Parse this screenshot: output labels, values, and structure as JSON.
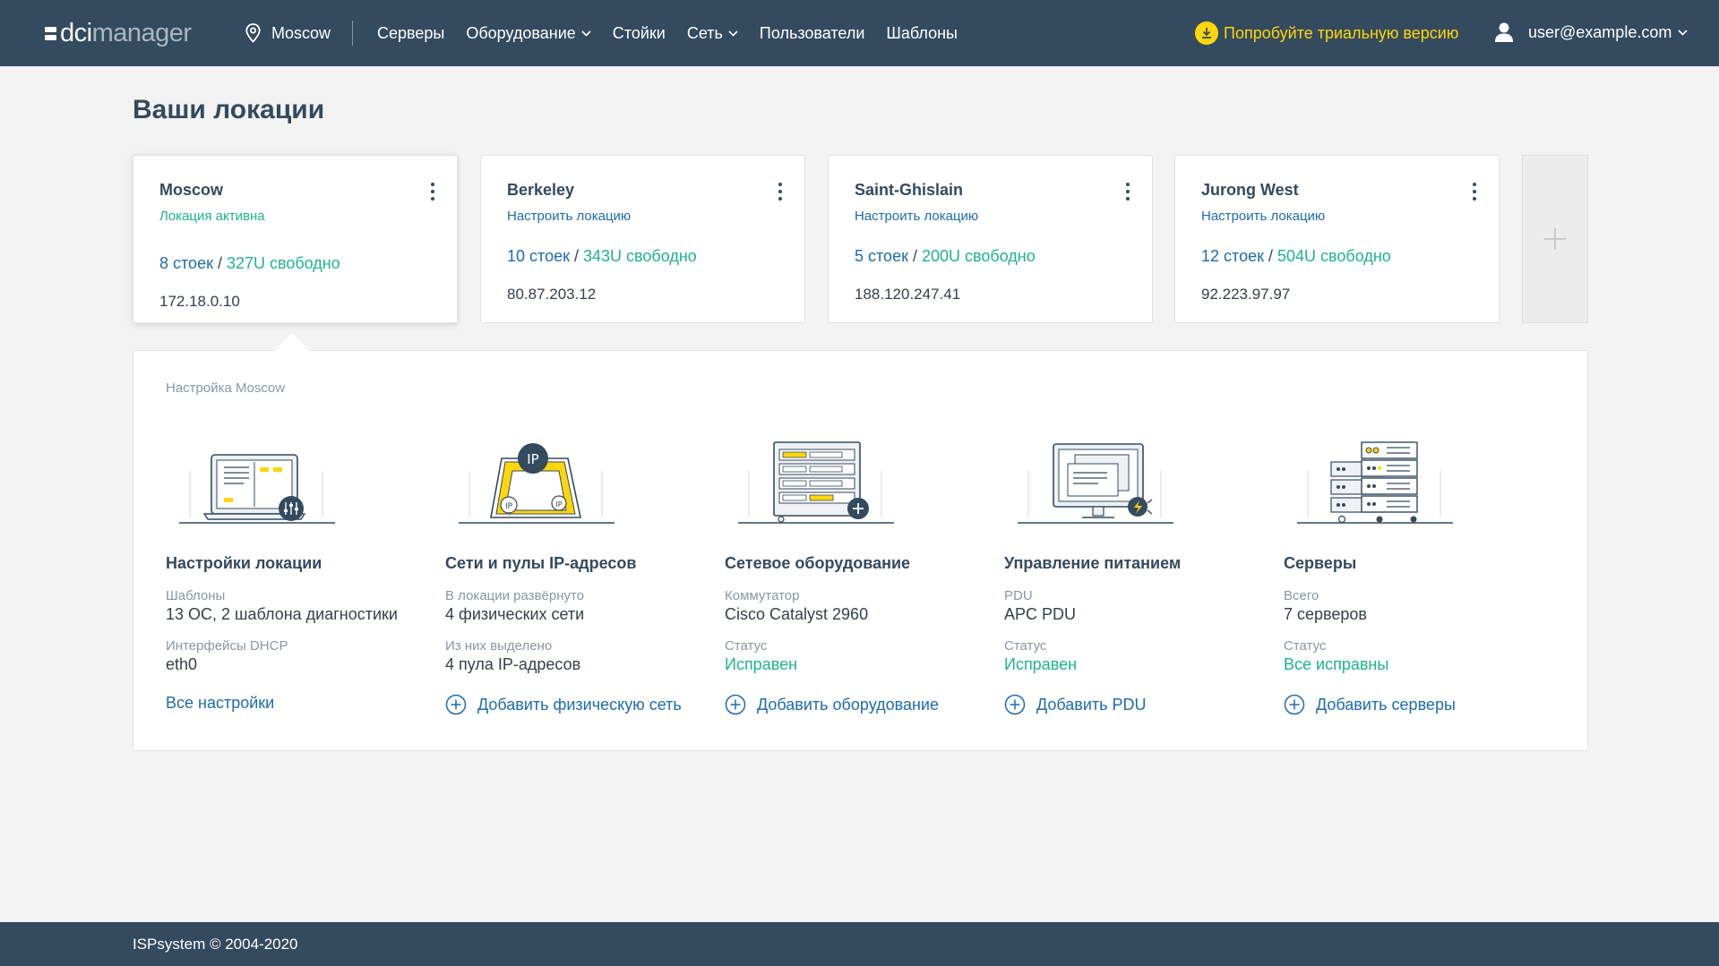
{
  "app": {
    "logo_left": "dci",
    "logo_right": "manager"
  },
  "header": {
    "current_location": "Moscow",
    "nav": [
      {
        "label": "Серверы",
        "dropdown": false
      },
      {
        "label": "Оборудование",
        "dropdown": true
      },
      {
        "label": "Стойки",
        "dropdown": false
      },
      {
        "label": "Сеть",
        "dropdown": true
      },
      {
        "label": "Пользователи",
        "dropdown": false
      },
      {
        "label": "Шаблоны",
        "dropdown": false
      }
    ],
    "trial_label": "Попробуйте триальную версию",
    "user_email": "user@example.com"
  },
  "page": {
    "title": "Ваши локации"
  },
  "locations": [
    {
      "name": "Moscow",
      "state": "Локация активна",
      "racks": "8 стоек",
      "sep": " / ",
      "free": "327U свободно",
      "ip": "172.18.0.10"
    },
    {
      "name": "Berkeley",
      "state": "Настроить локацию",
      "racks": "10 стоек",
      "sep": " / ",
      "free": "343U свободно",
      "ip": "80.87.203.12"
    },
    {
      "name": "Saint-Ghislain",
      "state": "Настроить локацию",
      "racks": "5 стоек",
      "sep": " / ",
      "free": "200U свободно",
      "ip": "188.120.247.41"
    },
    {
      "name": "Jurong West",
      "state": "Настроить локацию",
      "racks": "12 стоек",
      "sep": " / ",
      "free": "504U свободно",
      "ip": "92.223.97.97"
    }
  ],
  "panel": {
    "label": "Настройка Moscow",
    "columns": [
      {
        "title": "Настройки локации",
        "l1": "Шаблоны",
        "v1": "13 ОС, 2 шаблона диагностики",
        "l2": "Интерфейсы DHCP",
        "v2": "eth0",
        "action": "Все настройки"
      },
      {
        "title": "Сети и пулы IP-адресов",
        "l1": "В локации развёрнуто",
        "v1": "4 физических сети",
        "l2": "Из них выделено",
        "v2": "4 пула IP-адресов",
        "action": "Добавить физическую сеть"
      },
      {
        "title": "Сетевое оборудование",
        "l1": "Коммутатор",
        "v1": "Cisco Catalyst 2960",
        "l2": "Статус",
        "v2": "Исправен",
        "action": "Добавить оборудование"
      },
      {
        "title": "Управление питанием",
        "l1": "PDU",
        "v1": "APC PDU",
        "l2": "Статус",
        "v2": "Исправен",
        "action": "Добавить PDU"
      },
      {
        "title": "Серверы",
        "l1": "Всего",
        "v1": "7 серверов",
        "l2": "Статус",
        "v2": "Все исправны",
        "action": "Добавить серверы"
      }
    ],
    "ip_badge": "IP"
  },
  "footer": {
    "copyright": "ISPsystem © 2004-2020"
  },
  "colors": {
    "header_bg": "#344a5e",
    "accent_green": "#1fb38b",
    "link_blue": "#1d6bb0",
    "trial_yellow": "#ffd60a"
  }
}
